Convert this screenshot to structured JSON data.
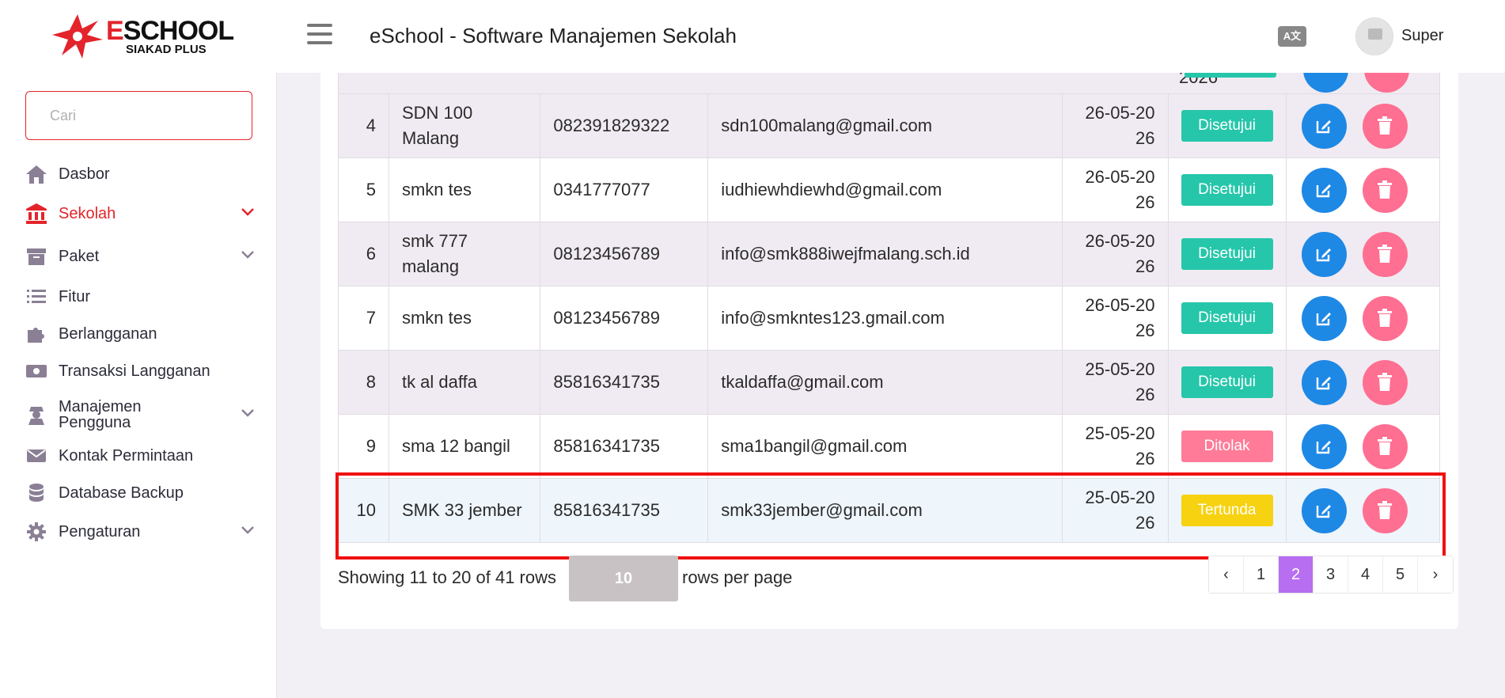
{
  "header": {
    "brand_text": "SCHOOL",
    "brand_first": "E",
    "brand_sub": "SIAKAD PLUS",
    "app_title": "eSchool - Software Manajemen Sekolah",
    "lang_label": "A文",
    "user_name": "Super"
  },
  "sidebar": {
    "search_placeholder": "Cari",
    "items": [
      {
        "label": "Dasbor",
        "icon": "home-icon"
      },
      {
        "label": "Sekolah",
        "icon": "school-icon",
        "active": true
      },
      {
        "label": "Paket",
        "icon": "archive-icon"
      },
      {
        "label": "Fitur",
        "icon": "list-icon"
      },
      {
        "label": "Berlangganan",
        "icon": "puzzle-icon"
      },
      {
        "label": "Transaksi Langganan",
        "icon": "money-icon"
      },
      {
        "label": "Manajemen Pengguna",
        "icon": "user-secret-icon"
      },
      {
        "label": "Kontak Permintaan",
        "icon": "envelope-icon"
      },
      {
        "label": "Database Backup",
        "icon": "database-icon"
      },
      {
        "label": "Pengaturan",
        "icon": "gear-icon"
      }
    ]
  },
  "table": {
    "cut_date": "2026",
    "rows": [
      {
        "no": "4",
        "name": "SDN 100 Malang",
        "phone": "082391829322",
        "email": "sdn100malang@gmail.com",
        "date": "26-05-2026",
        "status": "Disetujui"
      },
      {
        "no": "5",
        "name": "smkn tes",
        "phone": "0341777077",
        "email": "iudhiewhdiewhd@gmail.com",
        "date": "26-05-2026",
        "status": "Disetujui"
      },
      {
        "no": "6",
        "name": "smk 777 malang",
        "phone": "08123456789",
        "email": "info@smk888iwejfmalang.sch.id",
        "date": "26-05-2026",
        "status": "Disetujui"
      },
      {
        "no": "7",
        "name": "smkn tes",
        "phone": "08123456789",
        "email": "info@smkntes123.gmail.com",
        "date": "26-05-2026",
        "status": "Disetujui"
      },
      {
        "no": "8",
        "name": "tk al daffa",
        "phone": "85816341735",
        "email": "tkaldaffa@gmail.com",
        "date": "25-05-2026",
        "status": "Disetujui"
      },
      {
        "no": "9",
        "name": "sma 12 bangil",
        "phone": "85816341735",
        "email": "sma1bangil@gmail.com",
        "date": "25-05-2026",
        "status": "Ditolak"
      },
      {
        "no": "10",
        "name": "SMK 33 jember",
        "phone": "85816341735",
        "email": "smk33jember@gmail.com",
        "date": "25-05-2026",
        "status": "Tertunda"
      }
    ]
  },
  "status_colors": {
    "Disetujui": "#26c6aa",
    "Ditolak": "#ff7b98",
    "Tertunda": "#f7d210"
  },
  "footer": {
    "showing": "Showing 11 to 20 of 41 rows",
    "rows_per_page_value": "10",
    "rows_per_page_label": "rows per page",
    "pages": [
      "‹",
      "1",
      "2",
      "3",
      "4",
      "5",
      "›"
    ],
    "active_page": "2"
  }
}
